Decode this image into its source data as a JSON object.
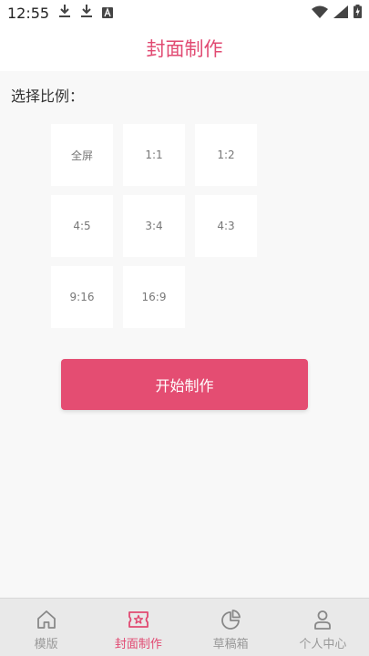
{
  "status_bar": {
    "time": "12:55",
    "icons": [
      "download-icon",
      "download-icon",
      "app-notification-icon"
    ],
    "right_icons": [
      "wifi-icon",
      "signal-icon",
      "battery-charging-icon"
    ]
  },
  "header": {
    "title": "封面制作"
  },
  "main": {
    "section_label": "选择比例：",
    "ratios": [
      {
        "label": "全屏"
      },
      {
        "label": "1:1"
      },
      {
        "label": "1:2"
      },
      {
        "label": "4:5"
      },
      {
        "label": "3:4"
      },
      {
        "label": "4:3"
      },
      {
        "label": "9:16"
      },
      {
        "label": "16:9"
      }
    ],
    "start_button": "开始制作"
  },
  "tabs": [
    {
      "label": "模版",
      "icon": "home-icon",
      "active": false
    },
    {
      "label": "封面制作",
      "icon": "ticket-icon",
      "active": true
    },
    {
      "label": "草稿箱",
      "icon": "pie-chart-icon",
      "active": false
    },
    {
      "label": "个人中心",
      "icon": "user-icon",
      "active": false
    }
  ],
  "colors": {
    "accent": "#e14a72",
    "button": "#e44d72",
    "background": "#f8f8f8",
    "tab_bar": "#e9e9e9",
    "tab_inactive": "#999999"
  }
}
